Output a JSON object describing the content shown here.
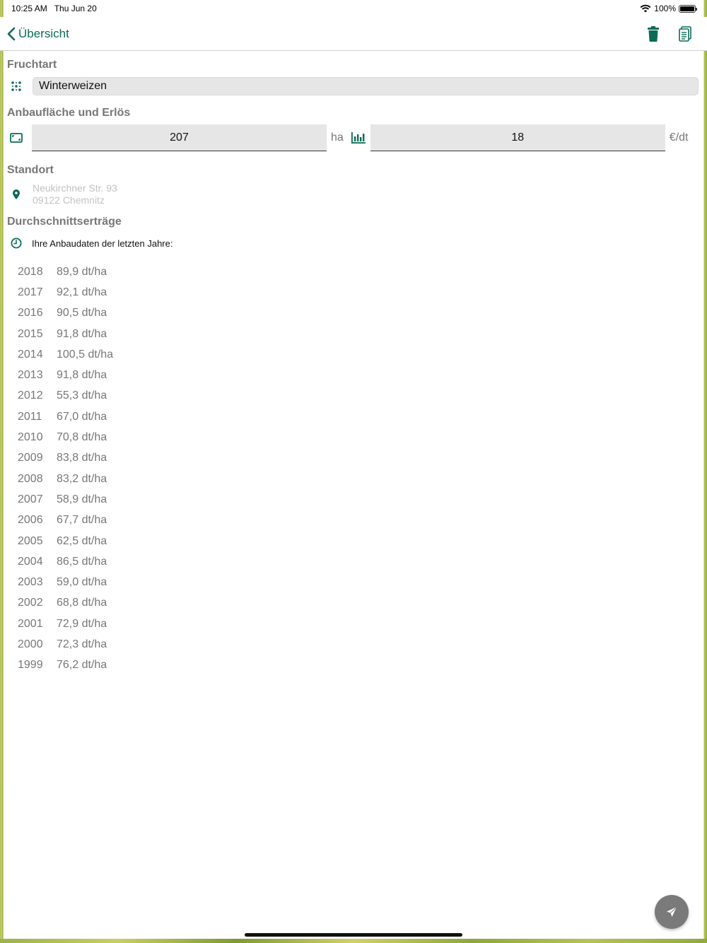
{
  "status": {
    "time": "10:25 AM",
    "date": "Thu Jun 20",
    "battery": "100%"
  },
  "nav": {
    "back_label": "Übersicht"
  },
  "crop": {
    "title": "Fruchtart",
    "value": "Winterweizen"
  },
  "area": {
    "title": "Anbaufläche und Erlös",
    "area_value": "207",
    "area_unit": "ha",
    "price_value": "18",
    "price_unit": "€/dt"
  },
  "location": {
    "title": "Standort",
    "line1": "Neukirchner Str. 93",
    "line2": "09122 Chemnitz"
  },
  "yields": {
    "title": "Durchschnittserträge",
    "hint": "Ihre Anbaudaten der letzten Jahre:",
    "rows": [
      {
        "year": "2018",
        "value": "89,9 dt/ha"
      },
      {
        "year": "2017",
        "value": "92,1 dt/ha"
      },
      {
        "year": "2016",
        "value": "90,5 dt/ha"
      },
      {
        "year": "2015",
        "value": "91,8 dt/ha"
      },
      {
        "year": "2014",
        "value": "100,5 dt/ha"
      },
      {
        "year": "2013",
        "value": "91,8 dt/ha"
      },
      {
        "year": "2012",
        "value": "55,3 dt/ha"
      },
      {
        "year": "2011",
        "value": "67,0 dt/ha"
      },
      {
        "year": "2010",
        "value": "70,8 dt/ha"
      },
      {
        "year": "2009",
        "value": "83,8 dt/ha"
      },
      {
        "year": "2008",
        "value": "83,2 dt/ha"
      },
      {
        "year": "2007",
        "value": "58,9 dt/ha"
      },
      {
        "year": "2006",
        "value": "67,7 dt/ha"
      },
      {
        "year": "2005",
        "value": "62,5 dt/ha"
      },
      {
        "year": "2004",
        "value": "86,5 dt/ha"
      },
      {
        "year": "2003",
        "value": "59,0 dt/ha"
      },
      {
        "year": "2002",
        "value": "68,8 dt/ha"
      },
      {
        "year": "2001",
        "value": "72,9 dt/ha"
      },
      {
        "year": "2000",
        "value": "72,3 dt/ha"
      },
      {
        "year": "1999",
        "value": "76,2 dt/ha"
      }
    ]
  },
  "colors": {
    "accent": "#0b6b57",
    "label_gray": "#777777",
    "field_bg": "#e6e6e6",
    "fab_bg": "#7a7a7a"
  },
  "icons": {
    "back": "chevron-left-icon",
    "delete": "trash-icon",
    "copy": "document-copy-icon",
    "crop": "seeds-icon",
    "area": "area-frame-icon",
    "price": "bar-chart-icon",
    "location": "map-pin-icon",
    "history": "clock-icon",
    "send": "paper-plane-icon"
  }
}
